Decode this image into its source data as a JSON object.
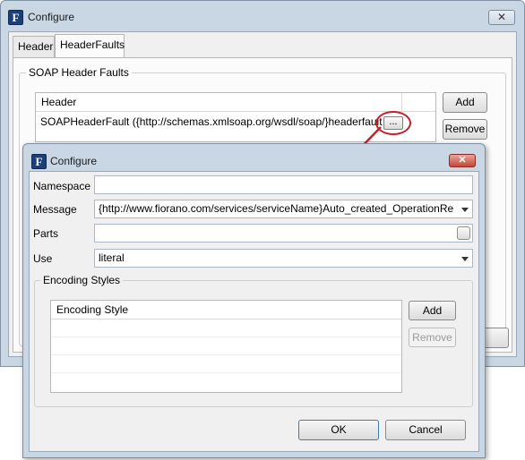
{
  "outer_window": {
    "title": "Configure",
    "app_icon": "F",
    "close_symbol": "✕",
    "tabs": [
      {
        "label": "Header"
      },
      {
        "label": "HeaderFaults"
      }
    ],
    "group_title": "SOAP Header Faults",
    "table": {
      "column_header": "Header",
      "rows": [
        {
          "value": "SOAPHeaderFault ({http://schemas.xmlsoap.org/wsdl/soap/}headerfault"
        }
      ]
    },
    "ellipsis_label": "...",
    "add_label": "Add",
    "remove_label": "Remove"
  },
  "inner_window": {
    "title": "Configure",
    "app_icon": "F",
    "close_symbol": "✕",
    "fields": {
      "namespace_label": "Namespace",
      "namespace_value": "",
      "message_label": "Message",
      "message_value": "{http://www.fiorano.com/services/serviceName}Auto_created_OperationRe",
      "parts_label": "Parts",
      "parts_value": "",
      "use_label": "Use",
      "use_value": "literal"
    },
    "encoding_group_title": "Encoding Styles",
    "encoding_table_header": "Encoding Style",
    "encoding_add_label": "Add",
    "encoding_remove_label": "Remove",
    "ok_label": "OK",
    "cancel_label": "Cancel"
  },
  "annotation": {
    "color": "#c4202a"
  }
}
